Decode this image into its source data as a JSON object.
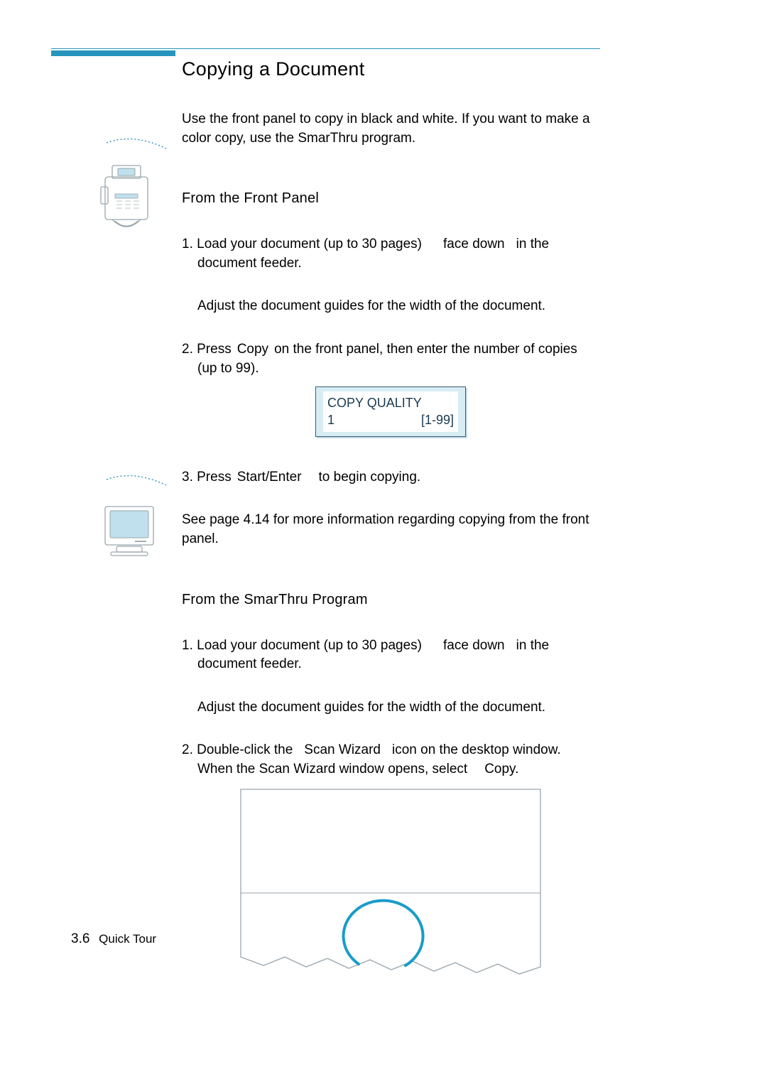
{
  "heading": "Copying a Document",
  "intro": "Use the front panel to copy in black and white. If you want to make a color copy, use the SmarThru program.",
  "section1": {
    "title": "From the Front Panel",
    "step1_a": "1. Load your document (up to 30 pages)",
    "step1_b": "face down",
    "step1_c": "in the document feeder.",
    "step1_sub": "Adjust the document guides for the width of the document.",
    "step2_a": "2. Press",
    "step2_b": "Copy",
    "step2_c": "on the front panel, then enter the number of copies (up to 99).",
    "display_line1": "COPY QUALITY",
    "display_line2_left": "1",
    "display_line2_right": "[1-99]",
    "step3_a": "3. Press",
    "step3_b": "Start/Enter",
    "step3_c": "to begin copying.",
    "note": "See page 4.14 for more information regarding copying from the front panel."
  },
  "section2": {
    "title": "From the SmarThru Program",
    "step1_a": "1. Load your document (up to 30 pages)",
    "step1_b": "face down",
    "step1_c": "in the document feeder.",
    "step1_sub": "Adjust the document guides for the width of the document.",
    "step2_a": "2. Double-click the",
    "step2_b": "Scan Wizard",
    "step2_c": "icon on the desktop window. When the Scan Wizard window opens, select",
    "step2_d": "Copy",
    "step2_e": "."
  },
  "footer": {
    "page_num": "3.6",
    "section": "Quick Tour"
  }
}
